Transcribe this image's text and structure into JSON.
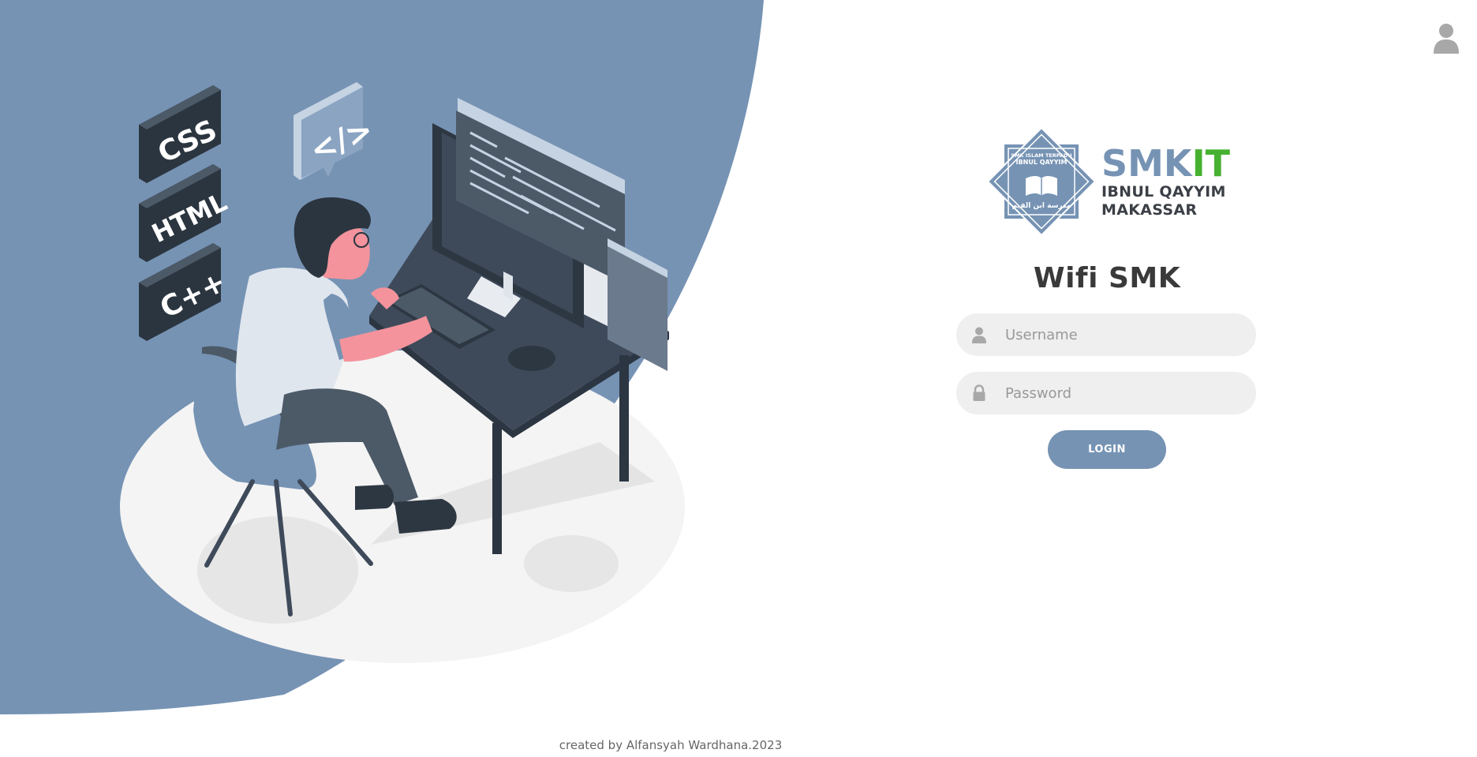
{
  "colors": {
    "accent": "#7693b4",
    "brand_green": "#46b130",
    "field_bg": "#efefef",
    "title": "#3a3a3a"
  },
  "icons": {
    "corner": "user-icon",
    "username": "user-icon",
    "password": "lock-icon"
  },
  "illustration": {
    "tags": [
      "CSS",
      "HTML",
      "C++"
    ],
    "code_bubble": "</>"
  },
  "logo": {
    "badge_top_line1": "SMK ISLAM TERPADU",
    "badge_top_line2": "IBNUL QAYYIM",
    "badge_arabic": "مدرسة ابن القيم",
    "smk": "SMK",
    "it": "IT",
    "line1": "IBNUL QAYYIM",
    "line2": "MAKASSAR"
  },
  "login": {
    "title": "Wifi SMK",
    "username_placeholder": "Username",
    "password_placeholder": "Password",
    "button_label": "LOGIN"
  },
  "footer": {
    "text": "created by Alfansyah Wardhana.2023"
  }
}
